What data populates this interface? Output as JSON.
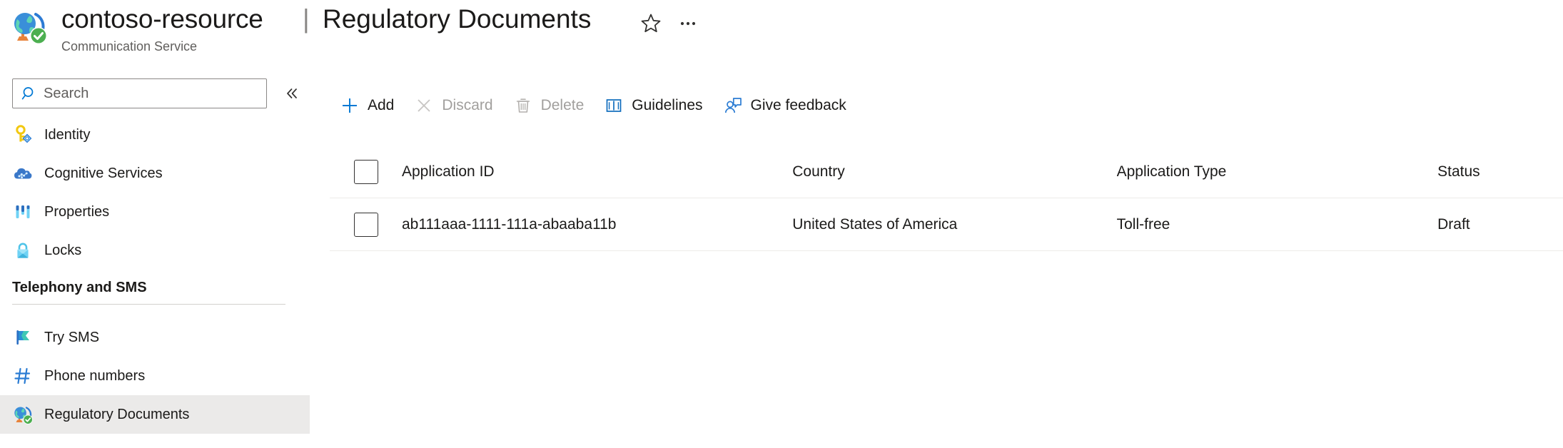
{
  "header": {
    "resource_icon": "globe-check-icon",
    "resource_name": "contoso-resource",
    "resource_type": "Communication Service",
    "divider": "|",
    "blade_title": "Regulatory Documents",
    "favorite_icon": "star-outline-icon",
    "more_icon": "ellipsis-icon"
  },
  "sidebar": {
    "search": {
      "placeholder": "Search",
      "value": "",
      "icon": "search-icon"
    },
    "collapse_icon": "double-chevron-left-icon",
    "items": [
      {
        "label": "Identity",
        "icon": "key-icon",
        "selected": false
      },
      {
        "label": "Cognitive Services",
        "icon": "cloud-ai-icon",
        "selected": false
      },
      {
        "label": "Properties",
        "icon": "properties-bars-icon",
        "selected": false
      },
      {
        "label": "Locks",
        "icon": "lock-icon",
        "selected": false
      }
    ],
    "section": {
      "title": "Telephony and SMS",
      "items": [
        {
          "label": "Try SMS",
          "icon": "flag-icon",
          "selected": false
        },
        {
          "label": "Phone numbers",
          "icon": "hash-icon",
          "selected": false
        },
        {
          "label": "Regulatory Documents",
          "icon": "globe-check-icon",
          "selected": true
        }
      ]
    }
  },
  "toolbar": {
    "commands": [
      {
        "label": "Add",
        "icon": "plus-icon",
        "disabled": false
      },
      {
        "label": "Discard",
        "icon": "close-x-icon",
        "disabled": true
      },
      {
        "label": "Delete",
        "icon": "trash-icon",
        "disabled": true
      },
      {
        "label": "Guidelines",
        "icon": "book-icon",
        "disabled": false
      },
      {
        "label": "Give feedback",
        "icon": "person-feedback-icon",
        "disabled": false
      }
    ]
  },
  "grid": {
    "select_all_checked": false,
    "columns": [
      "Application ID",
      "Country",
      "Application Type",
      "Status"
    ],
    "rows": [
      {
        "checked": false,
        "application_id": "ab111aaa-1111-111a-abaaba11b",
        "country": "United States of America",
        "application_type": "Toll-free",
        "status": "Draft"
      }
    ]
  },
  "colors": {
    "accent_blue": "#0078d4",
    "selected_row_bg": "#ebeae9",
    "disabled_text": "#a19f9d",
    "subtitle_text": "#605e5c",
    "divider": "#edebe9"
  }
}
